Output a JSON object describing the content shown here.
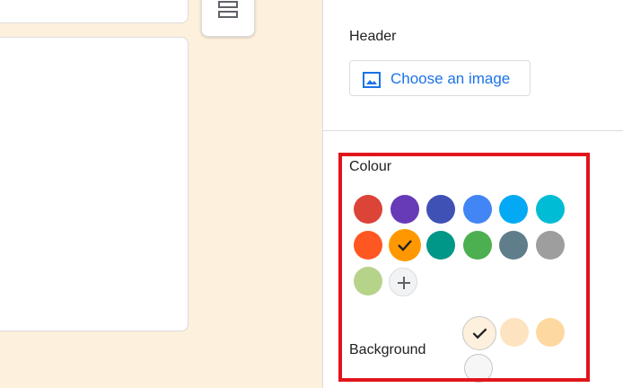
{
  "panel": {
    "header_label": "Header",
    "choose_image_label": "Choose an image",
    "colour_label": "Colour",
    "background_label": "Background",
    "selected_colour": "orange",
    "selected_background": "cream"
  },
  "colours": [
    {
      "name": "red",
      "hex": "#db4437"
    },
    {
      "name": "purple",
      "hex": "#673ab7"
    },
    {
      "name": "indigo",
      "hex": "#3f51b5"
    },
    {
      "name": "blue",
      "hex": "#4285f4"
    },
    {
      "name": "light-blue",
      "hex": "#03a9f4"
    },
    {
      "name": "cyan",
      "hex": "#00bcd4"
    },
    {
      "name": "deep-orange",
      "hex": "#ff5722"
    },
    {
      "name": "orange",
      "hex": "#ff9800"
    },
    {
      "name": "teal",
      "hex": "#009688"
    },
    {
      "name": "green",
      "hex": "#4caf50"
    },
    {
      "name": "blue-grey",
      "hex": "#607d8b"
    },
    {
      "name": "grey",
      "hex": "#9e9e9e"
    },
    {
      "name": "light-green",
      "hex": "#b6d38a"
    }
  ],
  "backgrounds": [
    {
      "name": "cream",
      "hex": "#fdf0dc"
    },
    {
      "name": "light-peach",
      "hex": "#fde3bf"
    },
    {
      "name": "peach",
      "hex": "#fdd9a1"
    },
    {
      "name": "light-grey",
      "hex": "#f6f6f6"
    }
  ],
  "icons": {
    "section": "section-icon",
    "image": "image-icon",
    "check": "check-icon",
    "add": "add-icon"
  }
}
